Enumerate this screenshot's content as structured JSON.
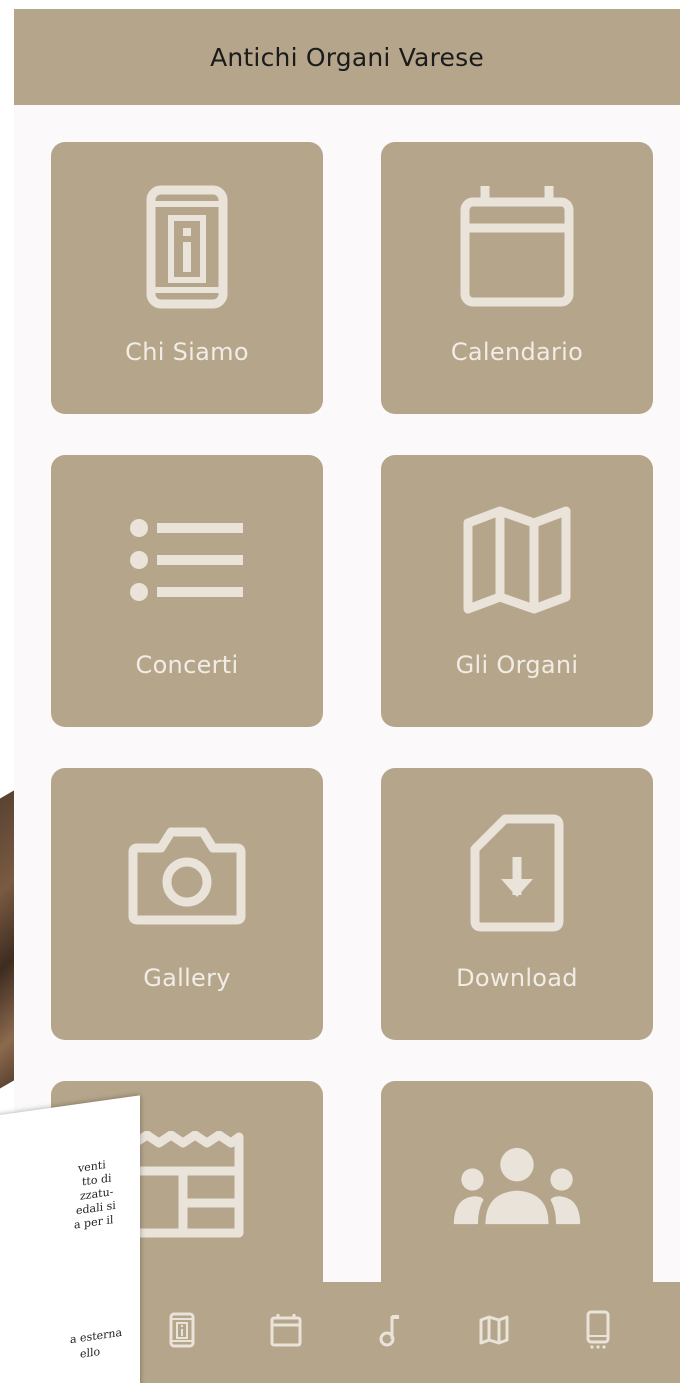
{
  "app": {
    "title": "Antichi Organi Varese"
  },
  "tiles": [
    {
      "label": "Chi Siamo",
      "icon": "info-phone-icon"
    },
    {
      "label": "Calendario",
      "icon": "calendar-icon"
    },
    {
      "label": "Concerti",
      "icon": "list-icon"
    },
    {
      "label": "Gli Organi",
      "icon": "map-icon"
    },
    {
      "label": "Gallery",
      "icon": "camera-icon"
    },
    {
      "label": "Download",
      "icon": "file-download-icon"
    },
    {
      "label": "",
      "icon": "newspaper-icon"
    },
    {
      "label": "",
      "icon": "groups-icon"
    }
  ],
  "bottom_nav": [
    {
      "icon": "info-phone-icon"
    },
    {
      "icon": "calendar-icon"
    },
    {
      "icon": "music-note-icon"
    },
    {
      "icon": "map-icon"
    },
    {
      "icon": "phone-more-icon"
    }
  ],
  "paper_text": {
    "lines_top": [
      "venti",
      "tto di",
      "zzatu-",
      "edali si",
      "a per il"
    ],
    "lines_bottom": [
      "a esterna",
      "ello"
    ],
    "fragment": "e"
  },
  "colors": {
    "accent": "#b5a58b",
    "icon": "#e9e3da",
    "background": "#fcf9fb",
    "title_text": "#1b1b1b"
  }
}
